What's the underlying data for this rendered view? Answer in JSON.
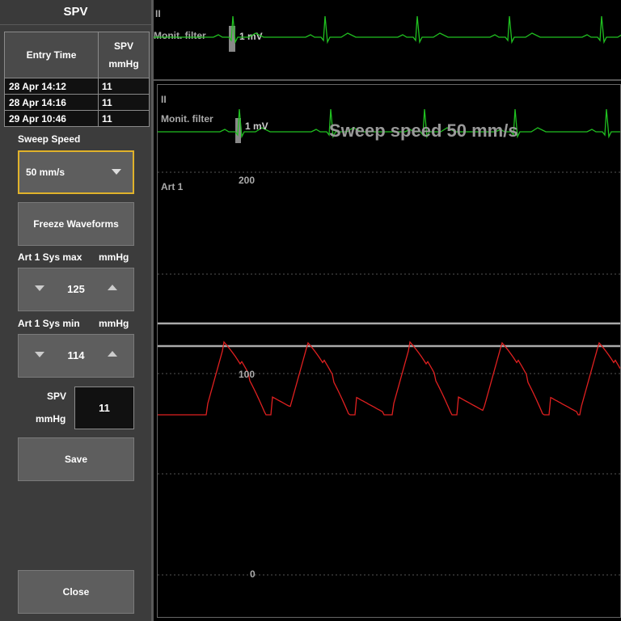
{
  "panel": {
    "title": "SPV",
    "table": {
      "headers": {
        "entry_time": "Entry Time",
        "spv_line1": "SPV",
        "spv_line2": "mmHg"
      },
      "rows": [
        {
          "time": "28 Apr 14:12",
          "spv": "11"
        },
        {
          "time": "28 Apr 14:16",
          "spv": "11"
        },
        {
          "time": "29 Apr 10:46",
          "spv": "11"
        }
      ]
    },
    "sweep_speed_label": "Sweep Speed",
    "sweep_speed_value": "50 mm/s",
    "freeze_label": "Freeze Waveforms",
    "sys_max": {
      "label": "Art 1 Sys max",
      "unit": "mmHg",
      "value": "125"
    },
    "sys_min": {
      "label": "Art 1 Sys min",
      "unit": "mmHg",
      "value": "114"
    },
    "spv": {
      "label": "SPV",
      "unit": "mmHg",
      "value": "11"
    },
    "save_label": "Save",
    "close_label": "Close"
  },
  "waveform": {
    "top_lead": "II",
    "top_filter": "Monit. filter",
    "top_scale": "1 mV",
    "main_lead": "II",
    "main_filter": "Monit. filter",
    "main_scale": "1 mV",
    "sweep_overlay": "Sweep speed 50 mm/s",
    "art_label": "Art 1",
    "scale_labels": {
      "high": "200",
      "mid": "100",
      "low": "0"
    },
    "colors": {
      "ecg": "#20c020",
      "art": "#e02020",
      "limit": "#aaaaaa",
      "accent": "#e0b22b"
    }
  }
}
